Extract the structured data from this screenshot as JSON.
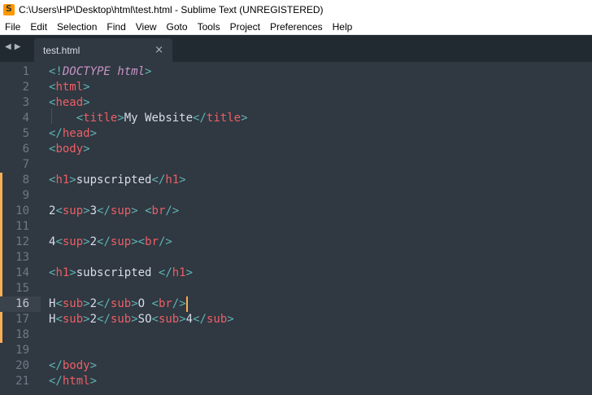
{
  "window": {
    "title": "C:\\Users\\HP\\Desktop\\html\\test.html - Sublime Text (UNREGISTERED)"
  },
  "menu": [
    "File",
    "Edit",
    "Selection",
    "Find",
    "View",
    "Goto",
    "Tools",
    "Project",
    "Preferences",
    "Help"
  ],
  "tab": {
    "label": "test.html",
    "close": "×",
    "nav_back": "◀",
    "nav_forward": "▶"
  },
  "editor": {
    "current_line": 16,
    "modified_lines": [
      8,
      9,
      10,
      11,
      12,
      13,
      14,
      15,
      16,
      17,
      18
    ],
    "colors": {
      "bg": "#303841",
      "punct": "#5fb4b4",
      "tag": "#ec5f66",
      "keyword": "#c695c6",
      "text": "#d8dee9",
      "caret": "#f9ae58"
    },
    "lines": [
      {
        "n": "1",
        "tokens": [
          [
            "p",
            "<!"
          ],
          [
            "k",
            "DOCTYPE html"
          ],
          [
            "p",
            ">"
          ]
        ]
      },
      {
        "n": "2",
        "tokens": [
          [
            "p",
            "<"
          ],
          [
            "t",
            "html"
          ],
          [
            "p",
            ">"
          ]
        ]
      },
      {
        "n": "3",
        "tokens": [
          [
            "p",
            "<"
          ],
          [
            "t",
            "head"
          ],
          [
            "p",
            ">"
          ]
        ]
      },
      {
        "n": "4",
        "tokens": [
          [
            "x",
            "    "
          ],
          [
            "p",
            "<"
          ],
          [
            "t",
            "title"
          ],
          [
            "p",
            ">"
          ],
          [
            "x",
            "My Website"
          ],
          [
            "p",
            "</"
          ],
          [
            "t",
            "title"
          ],
          [
            "p",
            ">"
          ]
        ]
      },
      {
        "n": "5",
        "tokens": [
          [
            "p",
            "</"
          ],
          [
            "t",
            "head"
          ],
          [
            "p",
            ">"
          ]
        ]
      },
      {
        "n": "6",
        "tokens": [
          [
            "p",
            "<"
          ],
          [
            "t",
            "body"
          ],
          [
            "p",
            ">"
          ]
        ]
      },
      {
        "n": "7",
        "tokens": []
      },
      {
        "n": "8",
        "tokens": [
          [
            "p",
            "<"
          ],
          [
            "t",
            "h1"
          ],
          [
            "p",
            ">"
          ],
          [
            "x",
            "supscripted"
          ],
          [
            "p",
            "</"
          ],
          [
            "t",
            "h1"
          ],
          [
            "p",
            ">"
          ]
        ]
      },
      {
        "n": "9",
        "tokens": []
      },
      {
        "n": "10",
        "tokens": [
          [
            "x",
            "2"
          ],
          [
            "p",
            "<"
          ],
          [
            "t",
            "sup"
          ],
          [
            "p",
            ">"
          ],
          [
            "x",
            "3"
          ],
          [
            "p",
            "</"
          ],
          [
            "t",
            "sup"
          ],
          [
            "p",
            ">"
          ],
          [
            "x",
            " "
          ],
          [
            "p",
            "<"
          ],
          [
            "t",
            "br"
          ],
          [
            "p",
            "/>"
          ]
        ]
      },
      {
        "n": "11",
        "tokens": []
      },
      {
        "n": "12",
        "tokens": [
          [
            "x",
            "4"
          ],
          [
            "p",
            "<"
          ],
          [
            "t",
            "sup"
          ],
          [
            "p",
            ">"
          ],
          [
            "x",
            "2"
          ],
          [
            "p",
            "</"
          ],
          [
            "t",
            "sup"
          ],
          [
            "p",
            ">"
          ],
          [
            "p",
            "<"
          ],
          [
            "t",
            "br"
          ],
          [
            "p",
            "/>"
          ]
        ]
      },
      {
        "n": "13",
        "tokens": []
      },
      {
        "n": "14",
        "tokens": [
          [
            "p",
            "<"
          ],
          [
            "t",
            "h1"
          ],
          [
            "p",
            ">"
          ],
          [
            "x",
            "subscripted "
          ],
          [
            "p",
            "</"
          ],
          [
            "t",
            "h1"
          ],
          [
            "p",
            ">"
          ]
        ]
      },
      {
        "n": "15",
        "tokens": []
      },
      {
        "n": "16",
        "tokens": [
          [
            "x",
            "H"
          ],
          [
            "p",
            "<"
          ],
          [
            "t",
            "sub"
          ],
          [
            "p",
            ">"
          ],
          [
            "x",
            "2"
          ],
          [
            "p",
            "</"
          ],
          [
            "t",
            "sub"
          ],
          [
            "p",
            ">"
          ],
          [
            "x",
            "O "
          ],
          [
            "p",
            "<"
          ],
          [
            "t",
            "br"
          ],
          [
            "p",
            "/>"
          ]
        ]
      },
      {
        "n": "17",
        "tokens": [
          [
            "x",
            "H"
          ],
          [
            "p",
            "<"
          ],
          [
            "t",
            "sub"
          ],
          [
            "p",
            ">"
          ],
          [
            "x",
            "2"
          ],
          [
            "p",
            "</"
          ],
          [
            "t",
            "sub"
          ],
          [
            "p",
            ">"
          ],
          [
            "x",
            "SO"
          ],
          [
            "p",
            "<"
          ],
          [
            "t",
            "sub"
          ],
          [
            "p",
            ">"
          ],
          [
            "x",
            "4"
          ],
          [
            "p",
            "</"
          ],
          [
            "t",
            "sub"
          ],
          [
            "p",
            ">"
          ]
        ]
      },
      {
        "n": "18",
        "tokens": []
      },
      {
        "n": "19",
        "tokens": []
      },
      {
        "n": "20",
        "tokens": [
          [
            "p",
            "</"
          ],
          [
            "t",
            "body"
          ],
          [
            "p",
            ">"
          ]
        ]
      },
      {
        "n": "21",
        "tokens": [
          [
            "p",
            "</"
          ],
          [
            "t",
            "html"
          ],
          [
            "p",
            ">"
          ]
        ]
      }
    ]
  }
}
